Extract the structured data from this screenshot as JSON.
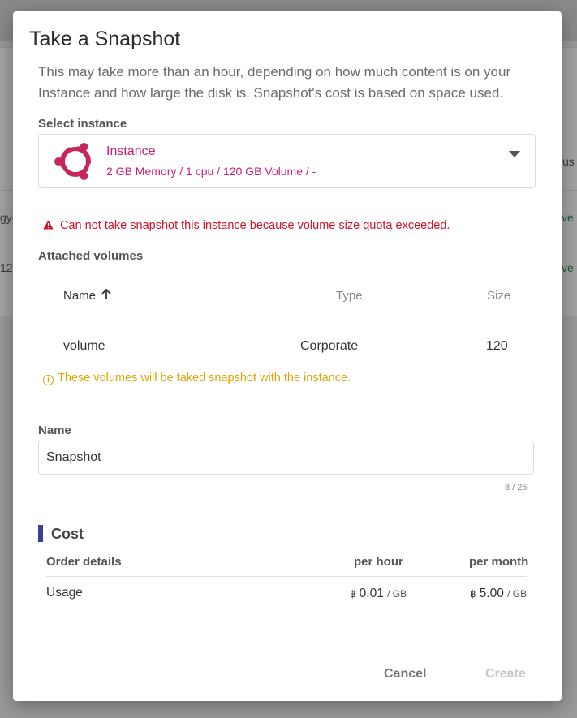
{
  "background": {
    "row1_text_left": "gy-",
    "row1_text_right": "ve",
    "row2_text_left": "12",
    "row2_text_right": "ve",
    "header_right": "us"
  },
  "modal": {
    "title": "Take a Snapshot",
    "description": "This may take more than an hour, depending on how much content is on your Instance and how large the disk is. Snapshot's cost is based on space used.",
    "select_instance_label": "Select instance",
    "instance": {
      "name": "Instance",
      "spec": "2 GB Memory / 1 cpu / 120 GB Volume / -",
      "icon": "ubuntu-icon"
    },
    "error_message": "Can not take snapshot this instance because volume size quota exceeded.",
    "attached_volumes_label": "Attached volumes",
    "volumes_table": {
      "headers": {
        "name": "Name",
        "type": "Type",
        "size": "Size"
      },
      "sort_icon": "arrow-up-icon",
      "rows": [
        {
          "name": "volume",
          "type": "Corporate",
          "size": "120"
        }
      ]
    },
    "info_message": "These volumes will be taked snapshot with the instance.",
    "name_label": "Name",
    "name_value": "Snapshot",
    "name_counter": "8 / 25",
    "cost": {
      "title": "Cost",
      "headers": {
        "details": "Order details",
        "per_hour": "per hour",
        "per_month": "per month"
      },
      "rows": [
        {
          "label": "Usage",
          "currency": "฿",
          "per_hour": "0.01",
          "per_month": "5.00",
          "unit": "/ GB"
        }
      ]
    },
    "buttons": {
      "cancel": "Cancel",
      "create": "Create"
    }
  },
  "colors": {
    "accent": "#cc1f7a",
    "error": "#d0122a",
    "warning": "#e3a300",
    "cost_bar": "#3d3f94"
  }
}
